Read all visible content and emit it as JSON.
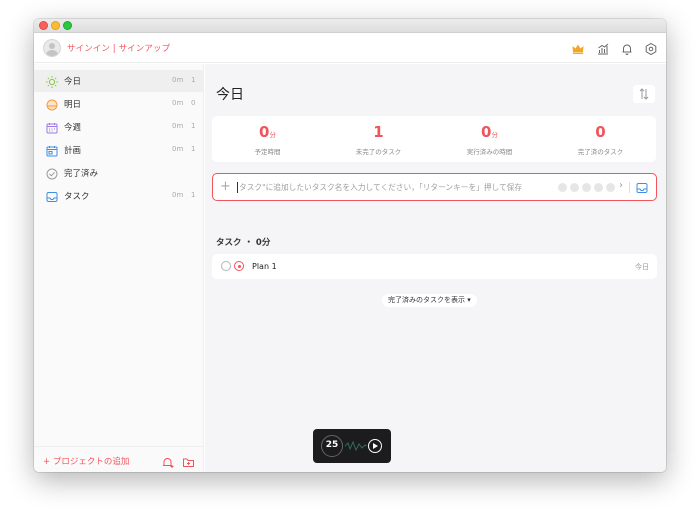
{
  "colors": {
    "accent": "#f2545b",
    "muted": "#aaaaaa",
    "sidebar_bg": "#fafafa",
    "main_bg": "#f5f5f7"
  },
  "header": {
    "signin_label": "サインイン | サインアップ",
    "icons": [
      "crown-icon",
      "stats-icon",
      "bell-icon",
      "settings-icon"
    ]
  },
  "sidebar": {
    "items": [
      {
        "label": "今日",
        "minutes": "0m",
        "count": "1",
        "icon": "sun-icon",
        "active": true
      },
      {
        "label": "明日",
        "minutes": "0m",
        "count": "0",
        "icon": "sunrise-icon",
        "active": false
      },
      {
        "label": "今週",
        "minutes": "0m",
        "count": "1",
        "icon": "calendar-week-icon",
        "active": false
      },
      {
        "label": "計画",
        "minutes": "0m",
        "count": "1",
        "icon": "calendar-plan-icon",
        "active": false
      },
      {
        "label": "完了済み",
        "minutes": "",
        "count": "",
        "icon": "check-circle-icon",
        "active": false
      },
      {
        "label": "タスク",
        "minutes": "0m",
        "count": "1",
        "icon": "inbox-icon",
        "active": false
      }
    ],
    "footer": {
      "add_project_label": "+ プロジェクトの追加"
    }
  },
  "main": {
    "title": "今日",
    "stats": [
      {
        "value": "0",
        "unit": "分",
        "caption": "予定時間"
      },
      {
        "value": "1",
        "unit": "",
        "caption": "未完了のタスク"
      },
      {
        "value": "0",
        "unit": "分",
        "caption": "実行済みの時間"
      },
      {
        "value": "0",
        "unit": "",
        "caption": "完了済のタスク"
      }
    ],
    "input": {
      "placeholder": "タスク\"に追加したいタスク名を入力してください，「リターンキーを」押して保存"
    },
    "section_header": "タスク ・ 0分",
    "tasks": [
      {
        "name": "Plan 1",
        "date": "今日"
      }
    ],
    "show_completed_label": "完了済みのタスクを表示 ▾"
  },
  "timer": {
    "value": "25"
  }
}
